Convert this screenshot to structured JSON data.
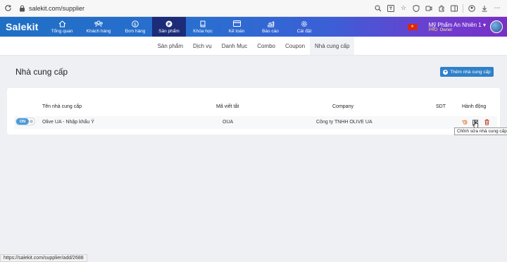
{
  "browser": {
    "url": "salekit.com/supplier",
    "status_url": "https://salekit.com/supplier/add/2688"
  },
  "app": {
    "logo": "Salekit",
    "nav": [
      {
        "label": "Tổng quan",
        "icon": "home-icon"
      },
      {
        "label": "Khách hàng",
        "icon": "users-icon"
      },
      {
        "label": "Đơn hàng",
        "icon": "dollar-icon"
      },
      {
        "label": "Sản phẩm",
        "icon": "product-icon",
        "active": true
      },
      {
        "label": "Khóa học",
        "icon": "book-icon"
      },
      {
        "label": "Kế toán",
        "icon": "card-icon"
      },
      {
        "label": "Báo cáo",
        "icon": "chart-icon"
      },
      {
        "label": "Cài đặt",
        "icon": "gear-icon"
      }
    ],
    "user": {
      "name": "Mỹ Phẩm An Nhiên 1",
      "role_tag": "PRO",
      "role": "Owner"
    }
  },
  "subnav": {
    "tabs": [
      "Sản phẩm",
      "Dịch vụ",
      "Danh Mục",
      "Combo",
      "Coupon",
      "Nhà cung cấp"
    ],
    "active": "Nhà cung cấp"
  },
  "page": {
    "title": "Nhà cung cấp",
    "add_button": "Thêm nhà cung cấp"
  },
  "table": {
    "headers": {
      "name": "Tên nhà cung cấp",
      "short": "Mã viết tắt",
      "company": "Company",
      "phone": "SDT",
      "actions": "Hành động"
    },
    "rows": [
      {
        "status": "ON",
        "name": "Olive UA - Nhập khẩu Ý",
        "short": "OUA",
        "company": "Công ty TNHH OLIVE UA",
        "phone": ""
      }
    ]
  },
  "tooltip": "Chỉnh sửa nhà cung cấp",
  "colors": {
    "brand": "#2a6ed0",
    "active_nav": "#1c2c78",
    "primary_button": "#2f80c9",
    "toggle_on": "#4a9bd8",
    "history_icon": "#e8792d",
    "delete_icon": "#c0392b"
  }
}
